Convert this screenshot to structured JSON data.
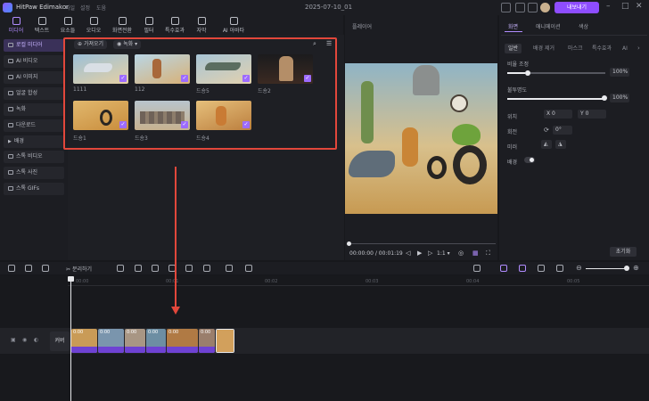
{
  "app": {
    "name": "HitPaw Edimakor",
    "menus": [
      "파일",
      "설정",
      "도움"
    ],
    "date": "2025-07-10_01",
    "export_label": "내보내기"
  },
  "toolbar": {
    "tools": [
      {
        "label": "미디어",
        "icon": "media-icon",
        "active": true
      },
      {
        "label": "텍스트",
        "icon": "text-icon",
        "active": false
      },
      {
        "label": "요소들",
        "icon": "elements-icon",
        "active": false
      },
      {
        "label": "오디오",
        "icon": "audio-icon",
        "active": false
      },
      {
        "label": "화면전환",
        "icon": "transition-icon",
        "active": false
      },
      {
        "label": "필터",
        "icon": "filter-icon",
        "active": false
      },
      {
        "label": "특수효과",
        "icon": "effects-icon",
        "active": false
      },
      {
        "label": "자막",
        "icon": "subtitle-icon",
        "active": false
      },
      {
        "label": "AI 아바타",
        "icon": "ai-avatar-icon",
        "active": false
      }
    ]
  },
  "sidebar": {
    "items": [
      {
        "label": "로컬 미디어",
        "active": true
      },
      {
        "label": "AI 비디오",
        "active": false
      },
      {
        "label": "AI 이미지",
        "active": false
      },
      {
        "label": "얼굴 합성",
        "active": false
      },
      {
        "label": "녹화",
        "active": false
      },
      {
        "label": "다운로드",
        "active": false
      },
      {
        "label": "배경",
        "active": false
      },
      {
        "label": "스톡 비디오",
        "active": false
      },
      {
        "label": "스톡 사진",
        "active": false
      },
      {
        "label": "스톡 GIFs",
        "active": false
      }
    ]
  },
  "media": {
    "import_label": "가져오기",
    "record_label": "녹화",
    "thumbnails": [
      {
        "label": "1111",
        "color": "#7fa3c2"
      },
      {
        "label": "112",
        "color": "#c9a46a"
      },
      {
        "label": "드숑5",
        "color": "#8aa8b8"
      },
      {
        "label": "드숑2",
        "color": "#6b4a3a"
      },
      {
        "label": "드숑1",
        "color": "#d9a45c"
      },
      {
        "label": "드숑3",
        "color": "#a69a8e"
      },
      {
        "label": "드숑4",
        "color": "#c88c4c"
      }
    ]
  },
  "player": {
    "title": "플레이어",
    "current_time": "00:00:00",
    "total_time": "00:01:19",
    "speed": "1:1"
  },
  "properties": {
    "tabs": [
      "화면",
      "애니메이션",
      "색상"
    ],
    "active_tab": "화면",
    "subtabs": [
      "일반",
      "배경 제거",
      "마스크",
      "특수효과",
      "AI"
    ],
    "opacity_label": "비율 조정",
    "opacity_value": "100%",
    "opacity_level": 1.0,
    "brightness_label": "불투명도",
    "brightness_value": "100%",
    "brightness_level": 1.0,
    "position_label": "위치",
    "x_label": "X",
    "x_value": "0",
    "y_label": "Y",
    "y_value": "0",
    "rotate_label": "회전",
    "rotate_value": "0°",
    "mirror_label": "미러",
    "background_label": "배경",
    "reset_label": "초기화"
  },
  "timeline": {
    "split_label": "분리하기",
    "ruler_ticks": [
      "00:00",
      "00:01",
      "00:02",
      "00:03",
      "00:04",
      "00:05"
    ],
    "track_label": "커버",
    "clips": [
      {
        "caption": "0:00",
        "color": "#c99b57"
      },
      {
        "caption": "0:00",
        "color": "#7a95ad"
      },
      {
        "caption": "0:00",
        "color": "#a89684"
      },
      {
        "caption": "0:00",
        "color": "#6d8ea3"
      },
      {
        "caption": "0:00",
        "color": "#b07a44"
      },
      {
        "caption": "0:00",
        "color": "#9a7e6c"
      },
      {
        "caption": "",
        "color": "#d2a05c"
      }
    ]
  }
}
